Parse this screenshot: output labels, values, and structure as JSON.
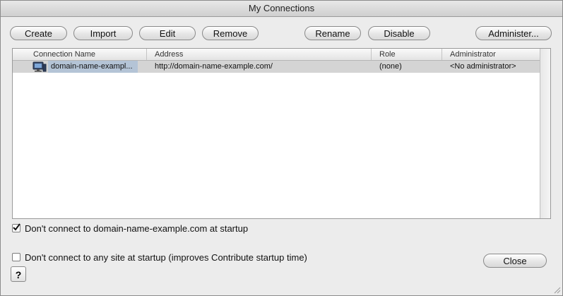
{
  "window": {
    "title": "My Connections"
  },
  "toolbar": {
    "create": "Create",
    "import": "Import",
    "edit": "Edit",
    "remove": "Remove",
    "rename": "Rename",
    "disable": "Disable",
    "administer": "Administer..."
  },
  "table": {
    "headers": [
      "Connection Name",
      "Address",
      "Role",
      "Administrator"
    ],
    "rows": [
      {
        "icon": "computer-icon",
        "name": "domain-name-exampl...",
        "address": "http://domain-name-example.com/",
        "role": "(none)",
        "administrator": "<No administrator>"
      }
    ]
  },
  "options": {
    "dont_connect_site": {
      "label": "Don't connect to domain-name-example.com at startup",
      "checked": true
    },
    "dont_connect_any": {
      "label": "Don't connect to any site at startup (improves Contribute startup time)",
      "checked": false
    }
  },
  "footer": {
    "close": "Close",
    "help": "?"
  }
}
